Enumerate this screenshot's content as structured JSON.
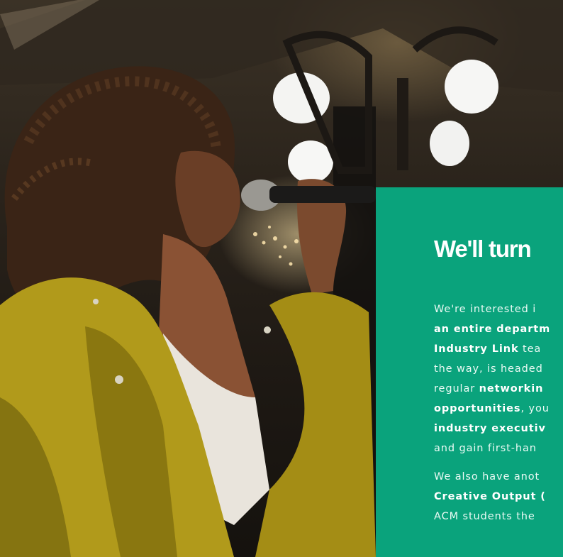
{
  "photo": {
    "subject": "singer-with-microphone"
  },
  "panel": {
    "background": "#0aa37c",
    "headline": "We'll turn",
    "paragraph1": [
      [
        {
          "t": "We're interested i",
          "b": false
        }
      ],
      [
        {
          "t": "an entire departm",
          "b": true
        }
      ],
      [
        {
          "t": "Industry Link",
          "b": true
        },
        {
          "t": " tea",
          "b": false
        }
      ],
      [
        {
          "t": "the way, is headed",
          "b": false
        }
      ],
      [
        {
          "t": "regular ",
          "b": false
        },
        {
          "t": "networkin",
          "b": true
        }
      ],
      [
        {
          "t": "opportunities",
          "b": true
        },
        {
          "t": ", you",
          "b": false
        }
      ],
      [
        {
          "t": "industry executiv",
          "b": true
        }
      ],
      [
        {
          "t": "and gain first-han",
          "b": false
        }
      ]
    ],
    "paragraph2": [
      [
        {
          "t": "We also have anot",
          "b": false
        }
      ],
      [
        {
          "t": "Creative Output (",
          "b": true
        }
      ],
      [
        {
          "t": "ACM students the",
          "b": false
        }
      ]
    ]
  }
}
